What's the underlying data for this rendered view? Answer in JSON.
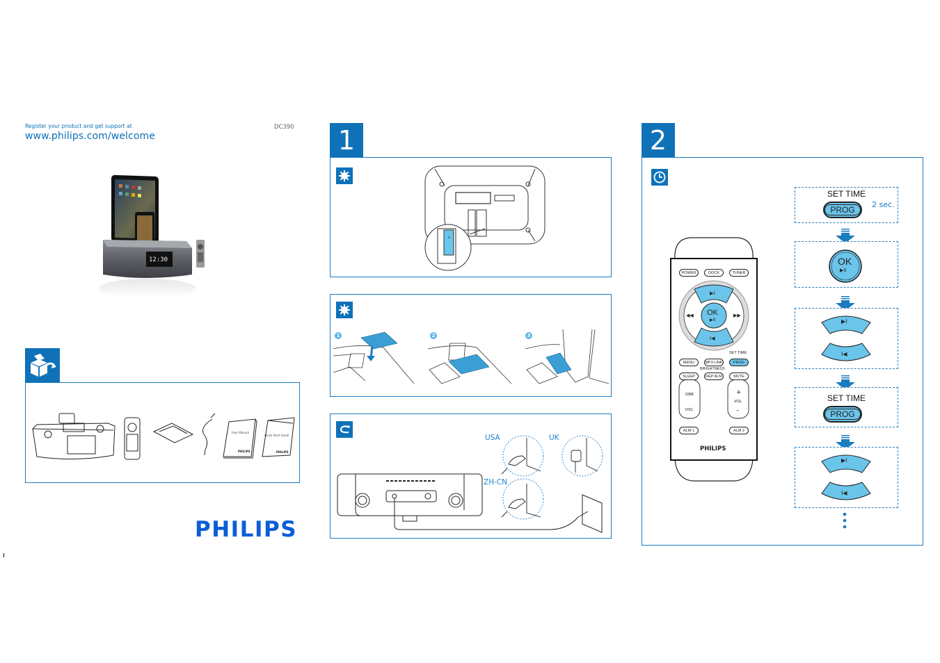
{
  "header": {
    "register_text": "Register your product and get support at",
    "url": "www.philips.com/welcome",
    "model": "DC390"
  },
  "brand": {
    "logo_text": "PHILIPS",
    "color": "#0b5ed7"
  },
  "colors": {
    "accent_blue": "#0f72b9",
    "highlight_blue": "#6bc4ea",
    "label_blue": "#1a86c8"
  },
  "in_the_box": {
    "icon": "unpack-box-icon",
    "items": [
      {
        "name": "docking-speaker",
        "label": ""
      },
      {
        "name": "remote-control",
        "label": ""
      },
      {
        "name": "dock-adapter",
        "label": ""
      },
      {
        "name": "audio-cable",
        "label": ""
      },
      {
        "name": "user-manual",
        "label": "User Manual",
        "logo": "PHILIPS"
      },
      {
        "name": "quick-start-guide",
        "label": "Quick Start Guide",
        "logo": "PHILIPS"
      }
    ]
  },
  "step1": {
    "number": "1",
    "panels": [
      {
        "icon": "gear-icon",
        "description": "battery-installation"
      },
      {
        "icon": "gear-icon",
        "description": "dock-adapter-installation",
        "steps": [
          "1",
          "2",
          "3"
        ]
      },
      {
        "icon": "power-plug-icon",
        "description": "power-connection",
        "regions": [
          "USA",
          "UK",
          "ZH-CN"
        ]
      }
    ]
  },
  "step2": {
    "number": "2",
    "icon": "clock-icon",
    "remote": {
      "top_buttons": [
        "POWER",
        "DOCK",
        "TUNER"
      ],
      "ok_label": "OK",
      "ok_sub": "▶II",
      "next_symbol": "▶I",
      "prev_symbol": "I◀",
      "rew_symbol": "◀◀",
      "ff_symbol": "▶▶",
      "set_time_label": "SET TIME",
      "brightness_label": "BRIGHTNESS",
      "row1": [
        "MENU",
        "MP3 LINK",
        "PROG"
      ],
      "row2": [
        "SLEEP",
        "REP ALM",
        "MUTE"
      ],
      "left_rocker": [
        "DBB",
        "DSC"
      ],
      "vol": {
        "plus": "+",
        "label": "VOL",
        "minus": "–"
      },
      "alarm_buttons": [
        "ALM 1",
        "ALM 2"
      ],
      "brand": "PHILIPS"
    },
    "sequence": [
      {
        "type": "prog",
        "title": "SET TIME",
        "button": "PROG",
        "hold": "2 sec."
      },
      {
        "type": "ok",
        "button": "OK",
        "sub": "▶II"
      },
      {
        "type": "updown",
        "up": "▶I",
        "down": "I◀"
      },
      {
        "type": "prog",
        "title": "SET TIME",
        "button": "PROG"
      },
      {
        "type": "updown",
        "up": "▶I",
        "down": "I◀"
      }
    ],
    "continue_marker": "⋮"
  }
}
